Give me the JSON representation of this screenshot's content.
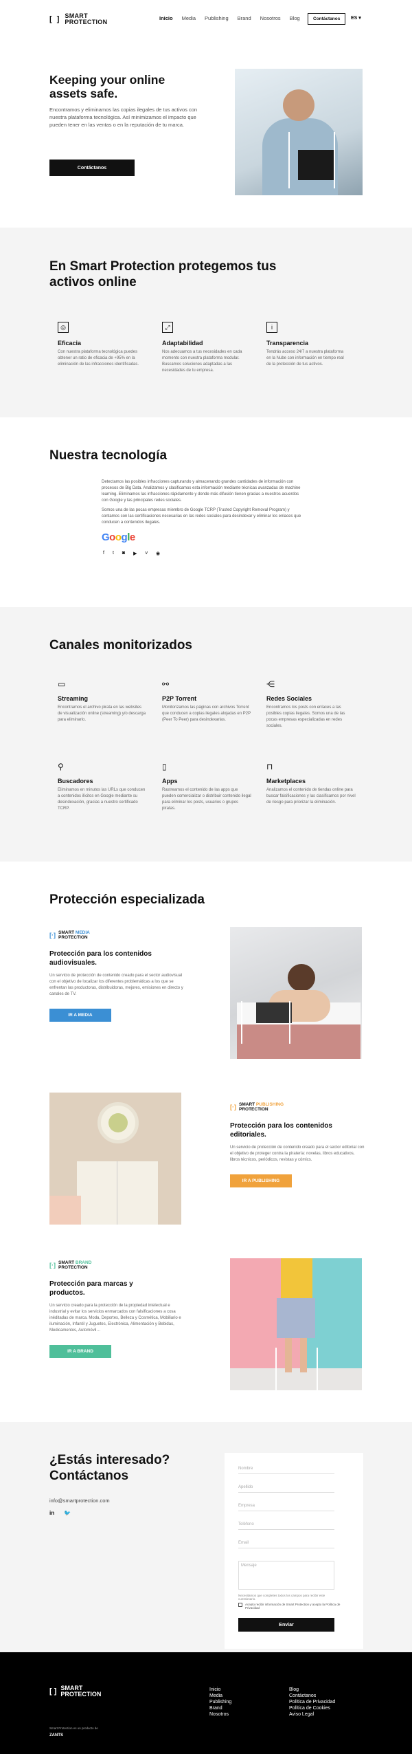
{
  "header": {
    "logo_brackets": "[ ]",
    "logo_line1": "SMART",
    "logo_line2": "PROTECTION",
    "nav": [
      "Inicio",
      "Media",
      "Publishing",
      "Brand",
      "Nosotros",
      "Blog"
    ],
    "contact": "Contáctanos",
    "lang": "ES ▾"
  },
  "hero": {
    "title": "Keeping your online assets safe.",
    "text": "Encontramos y eliminamos las copias ilegales de tus activos con nuestra plataforma tecnológica. Así minimizamos el impacto que pueden tener en las ventas o en la reputación de tu marca.",
    "cta": "Contáctanos"
  },
  "values": {
    "title": "En Smart Protection protegemos tus activos online",
    "items": [
      {
        "icon": "target-icon",
        "glyph": "◎",
        "title": "Eficacia",
        "text": "Con nuestra plataforma tecnológica puedes obtener un ratio de eficacia de +95% en la eliminación de las infracciones identificadas."
      },
      {
        "icon": "expand-icon",
        "glyph": "⤢",
        "title": "Adaptabilidad",
        "text": "Nos adecuamos a tus necesidades en cada momento con nuestra plataforma modular. Buscamos soluciones adaptadas a las necesidades de tu empresa."
      },
      {
        "icon": "info-icon",
        "glyph": "i",
        "title": "Transparencia",
        "text": "Tendrás acceso 24/7 a nuestra plataforma en la Nube con información en tiempo real de la protección de tus activos."
      }
    ]
  },
  "tech": {
    "title": "Nuestra tecnología",
    "p1": "Detectamos las posibles infracciones capturando y almacenando grandes cantidades de información con procesos de Big Data. Analizamos y clasificamos esta información mediante técnicas avanzadas de machine learning. Eliminamos las infracciones rápidamente y donde más difusión tienen gracias a nuestros acuerdos con Google y las principales redes sociales.",
    "p2": "Somos una de las pocas empresas miembro de Google TCRP (Trusted Copyright Removal Program) y contamos con las certificaciones necesarias en las redes sociales para desindexar y eliminar los enlaces que conducen a contenidos ilegales.",
    "google": "Google",
    "socials": [
      "f",
      "t",
      "◙",
      "▶",
      "v",
      "◉"
    ]
  },
  "channels": {
    "title": "Canales monitorizados",
    "items": [
      {
        "icon": "screen-icon",
        "glyph": "▭",
        "title": "Streaming",
        "text": "Encontramos el archivo pirata en las websites de visualización online (streaming) y/o descarga para eliminarlo."
      },
      {
        "icon": "p2p-icon",
        "glyph": "⚯",
        "title": "P2P Torrent",
        "text": "Monitorizamos las páginas con archivos Torrent que conducen a copias ilegales alojadas en P2P (Peer To Peer) para desindexarlas."
      },
      {
        "icon": "share-icon",
        "glyph": "⋲",
        "title": "Redes Sociales",
        "text": "Encontramos los posts con enlaces a las posibles copias ilegales. Somos una de las pocas empresas especializadas en redes sociales."
      },
      {
        "icon": "search-icon",
        "glyph": "⚲",
        "title": "Buscadores",
        "text": "Eliminamos en minutos las URLs que conducen a contenidos ilícitos en Google mediante su desindexación, gracias a nuestro certificado TCRP."
      },
      {
        "icon": "phone-icon",
        "glyph": "▯",
        "title": "Apps",
        "text": "Rastreamos el contenido de las apps que pueden comercializar o distribuir contenido ilegal para eliminar los posts, usuarios o grupos piratas."
      },
      {
        "icon": "bag-icon",
        "glyph": "⊓",
        "title": "Marketplaces",
        "text": "Analizamos el contenido de tiendas online para buscar falsificaciones y las clasificamos por nivel de riesgo para priorizar la eliminación."
      }
    ]
  },
  "protection": {
    "title": "Protección especializada",
    "media": {
      "brand1": "SMART",
      "brand2": "MEDIA",
      "brand3": "PROTECTION",
      "title": "Protección para los contenidos audiovisuales.",
      "text": "Un servicio de protección de contenido creado para el sector audiovisual con el objetivo de localizar los diferentes problemáticas a los que se enfrentan las productoras, distribuidoras, mejores, emisiones en directo y canales de TV.",
      "button": "IR A MEDIA",
      "color": "#3b8fd4"
    },
    "publishing": {
      "brand1": "SMART",
      "brand2": "PUBLISHING",
      "brand3": "PROTECTION",
      "title": "Protección para los contenidos editoriales.",
      "text": "Un servicio de protección de contenido creado para el sector editorial con el objetivo de proteger contra la piratería: novelas, libros educativos, libros técnicos, periódicos, revistas y cómics.",
      "button": "IR A PUBLISHING",
      "color": "#f0a23c"
    },
    "brand": {
      "brand1": "SMART",
      "brand2": "BRAND",
      "brand3": "PROTECTION",
      "title": "Protección para marcas y productos.",
      "text": "Un servicio creado para la protección de la propiedad intelectual e industrial y evitar los servicios enmarcados con falsificaciones a cosa inéditadas de marca. Moda, Deportes, Belleza y Cosmética, Mobiliario e iluminación, Infantil y Juguetes, Electrónica, Alimentación y Bebidas, Medicamentos, Automóvil…",
      "button": "IR A BRAND",
      "color": "#4fbf9a"
    }
  },
  "contact": {
    "title": "¿Estás interesado? Contáctanos",
    "email": "info@smartprotection.com",
    "socials": [
      "in",
      "🐦"
    ],
    "fields": [
      "Nombre",
      "Apellido",
      "Empresa",
      "Teléfono",
      "Email"
    ],
    "message": "Mensaje",
    "note": "Necesitamos que completes todos los campos para recibir este cuestionario.",
    "consent": "Acepto recibir información de Smart Protection y acepto la Política de Privacidad",
    "send": "Enviar"
  },
  "footer": {
    "logo_brackets": "[ ]",
    "logo_line1": "SMART",
    "logo_line2": "PROTECTION",
    "col1": [
      "Inicio",
      "Media",
      "Publishing",
      "Brand",
      "Nosotros"
    ],
    "col2": [
      "Blog",
      "Contáctanos",
      "Política de Privacidad",
      "Política de Cookies",
      "Aviso Legal"
    ],
    "product_of": "Smart Protection es un producto de",
    "zanta": "ZANTS"
  }
}
